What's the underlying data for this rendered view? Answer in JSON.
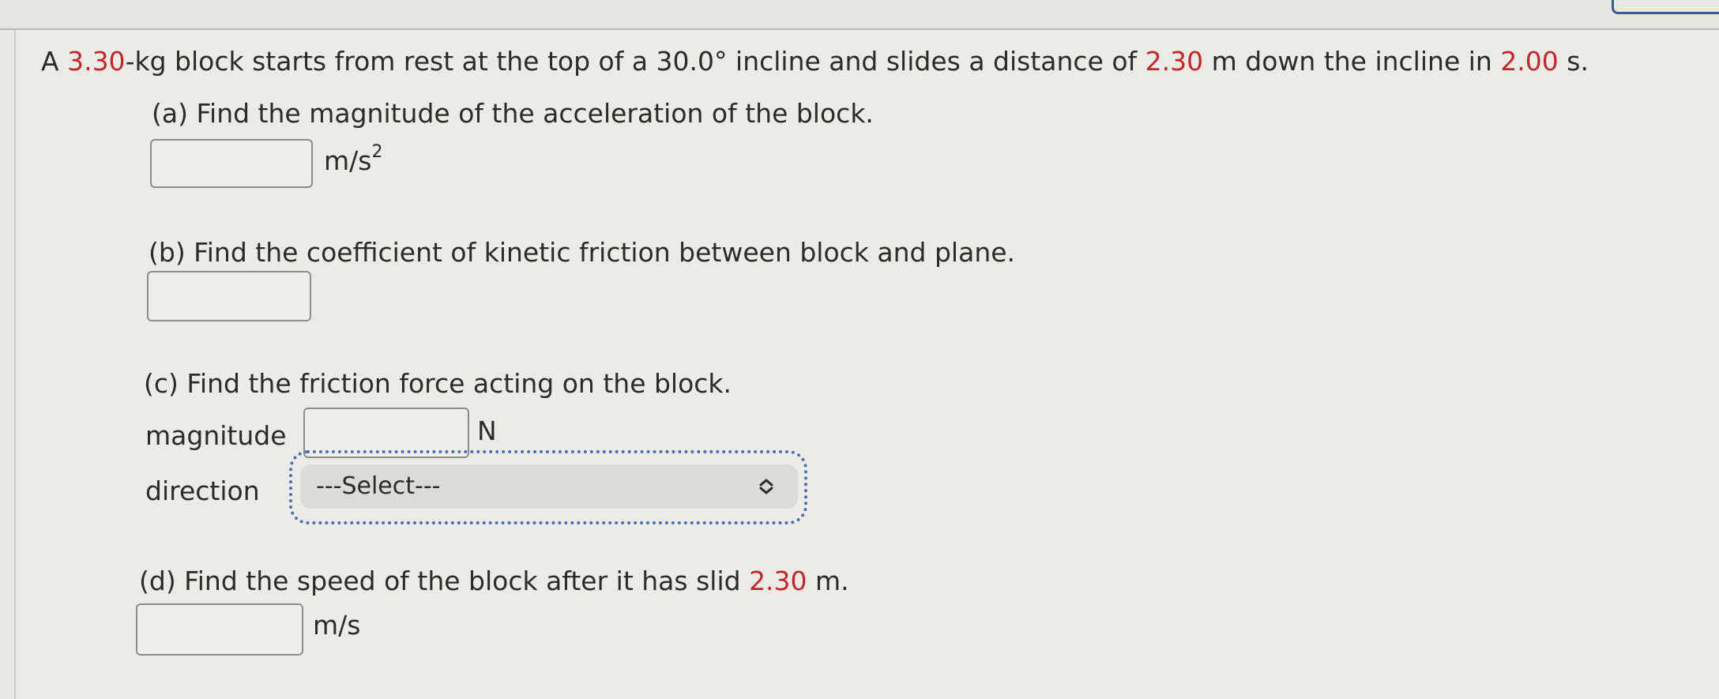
{
  "problem": {
    "intro_1": "A ",
    "mass": "3.30",
    "intro_2": "-kg block starts from rest at the top of a ",
    "angle": "30.0°",
    "intro_3": " incline and slides a distance of ",
    "distance": "2.30",
    "intro_4": " m down the incline in ",
    "time": "2.00",
    "intro_5": " s."
  },
  "part_a": {
    "question": "(a) Find the magnitude of the acceleration of the block.",
    "unit": "m/s",
    "unit_exp": "2",
    "value": ""
  },
  "part_b": {
    "question": "(b) Find the coefficient of kinetic friction between block and plane.",
    "value": ""
  },
  "part_c": {
    "question": "(c) Find the friction force acting on the block.",
    "magnitude_label": "magnitude",
    "magnitude_unit": "N",
    "magnitude_value": "",
    "direction_label": "direction",
    "direction_selected": "---Select---"
  },
  "part_d": {
    "question_1": "(d) Find the speed of the block after it has slid ",
    "distance": "2.30",
    "question_2": " m.",
    "unit": "m/s",
    "value": ""
  },
  "icons": {
    "select_chevron": "chevron-up-down-icon"
  }
}
